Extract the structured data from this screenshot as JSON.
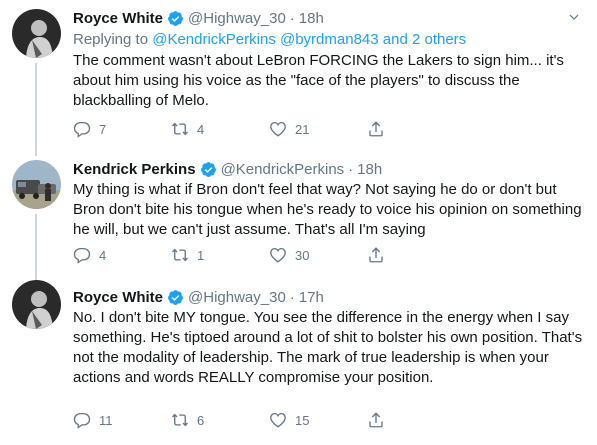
{
  "tweets": [
    {
      "name": "Royce White",
      "handle": "@Highway_30",
      "sep": "·",
      "time": "18h",
      "reply_prefix": "Replying to",
      "reply_targets": "@KendrickPerkins @byrdman843 and 2 others",
      "text": "The comment wasn't about LeBron FORCING the Lakers to sign him... it's about him using his voice as the \"face of the players\" to discuss the blackballing of Melo.",
      "replies": "7",
      "retweets": "4",
      "likes": "21"
    },
    {
      "name": "Kendrick Perkins",
      "handle": "@KendrickPerkins",
      "sep": "·",
      "time": "18h",
      "text": "My thing is what if Bron don't feel that way? Not saying he do or don't but Bron don't bite his tongue when he's ready to voice his opinion on something he will, but we can't just assume. That's all I'm saying",
      "replies": "4",
      "retweets": "1",
      "likes": "30"
    },
    {
      "name": "Royce White",
      "handle": "@Highway_30",
      "sep": "·",
      "time": "17h",
      "text": "No. I don't bite MY tongue. You see the difference in the energy when I say something. He's tiptoed around a lot of shit to bolster his own position. That's not the modality of leadership. The mark of true leadership is when your actions and words REALLY compromise your position.",
      "replies": "11",
      "retweets": "6",
      "likes": "15"
    }
  ],
  "colors": {
    "accent": "#1da1f2",
    "secondary_text": "#657786",
    "thread_line": "#ccd6dd"
  },
  "icons": [
    "verified-badge-icon",
    "chevron-down-icon",
    "reply-icon",
    "retweet-icon",
    "like-icon",
    "share-icon"
  ]
}
